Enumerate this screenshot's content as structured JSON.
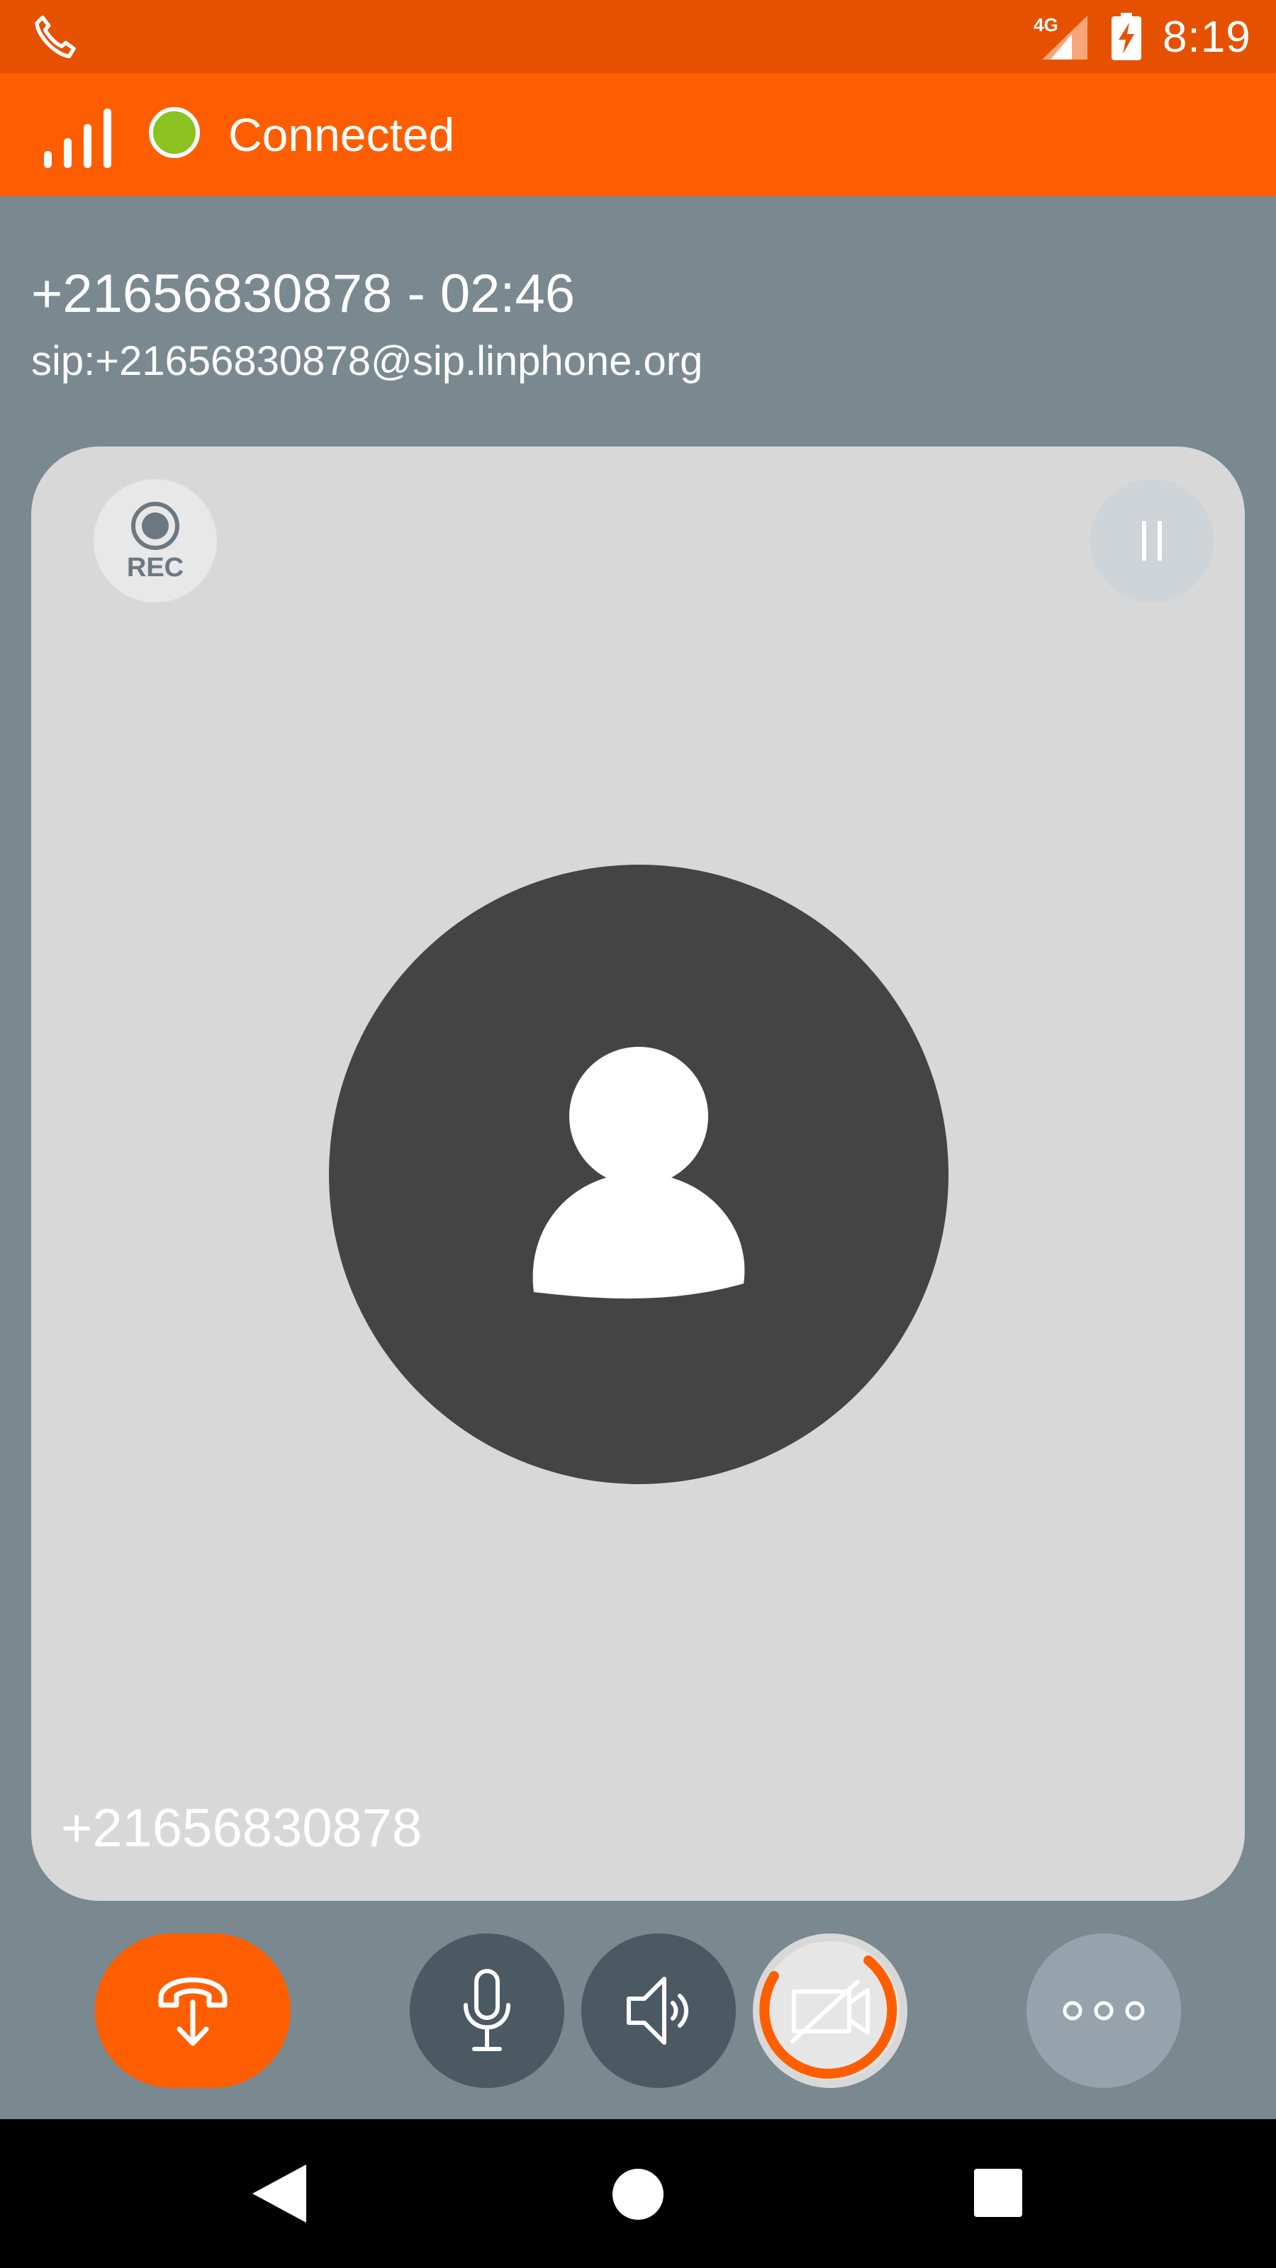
{
  "status_bar": {
    "time": "8:19",
    "network_type": "4G",
    "phone_icon": "phone-icon",
    "battery_icon": "battery-charging-icon"
  },
  "top_bar": {
    "signal_icon": "signal-bars-icon",
    "connection_status": "Connected",
    "status_color": "#8bc220"
  },
  "call": {
    "title": "+21656830878 - 02:46",
    "sip_address": "sip:+21656830878@sip.linphone.org"
  },
  "call_card": {
    "rec_label": "REC",
    "pause_icon": "pause-icon",
    "avatar_icon": "contact-avatar-icon",
    "caller_number": "+21656830878"
  },
  "controls": {
    "hangup_icon": "hangup-icon",
    "mic_icon": "microphone-icon",
    "speaker_icon": "speaker-icon",
    "video_icon": "video-off-icon",
    "more_icon": "more-options-icon"
  },
  "nav_bar": {
    "back_icon": "back-icon",
    "home_icon": "home-icon",
    "recent_icon": "recent-apps-icon"
  },
  "colors": {
    "status_bar": "#e65100",
    "accent": "#ff5e00",
    "background": "#7a8890",
    "card": "#d8d8d8",
    "control_dark": "#4b5963",
    "more_button": "#96a3ad",
    "avatar": "#444444"
  }
}
